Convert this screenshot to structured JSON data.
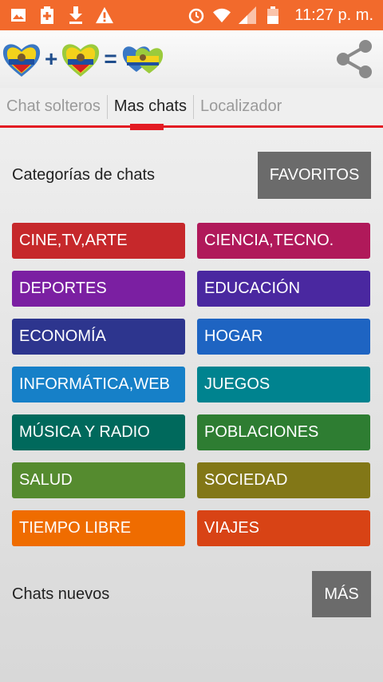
{
  "status_bar": {
    "time": "11:27 p. m.",
    "left_icons": [
      "image-icon",
      "battery-plus-icon",
      "download-icon",
      "warning-icon"
    ],
    "right_icons": [
      "alarm-icon",
      "wifi-icon",
      "signal-icon",
      "battery-icon"
    ]
  },
  "app_bar": {
    "logo_plus": "+",
    "logo_equals": "=",
    "share_icon": "share-icon"
  },
  "tabs": [
    {
      "label": "Chat solteros"
    },
    {
      "label": "Mas chats"
    },
    {
      "label": "Localizador"
    }
  ],
  "active_tab": "Mas chats",
  "categories_section": {
    "title": "Categorías de chats",
    "favorites_button": "FAVORITOS"
  },
  "categories": [
    {
      "label": "CINE,TV,ARTE",
      "color": "#c6282b"
    },
    {
      "label": "CIENCIA,TECNO.",
      "color": "#b0195a"
    },
    {
      "label": "DEPORTES",
      "color": "#7b1fa2"
    },
    {
      "label": "EDUCACIÓN",
      "color": "#4a28a0"
    },
    {
      "label": "ECONOMÍA",
      "color": "#2d358e"
    },
    {
      "label": "HOGAR",
      "color": "#1e64c2"
    },
    {
      "label": "INFORMÁTICA,WEB",
      "color": "#1680c8"
    },
    {
      "label": "JUEGOS",
      "color": "#00838f"
    },
    {
      "label": "MÚSICA Y RADIO",
      "color": "#00695c"
    },
    {
      "label": "POBLACIONES",
      "color": "#2e7d32"
    },
    {
      "label": "SALUD",
      "color": "#558b2f"
    },
    {
      "label": "SOCIEDAD",
      "color": "#827717"
    },
    {
      "label": "TIEMPO LIBRE",
      "color": "#ef6c00"
    },
    {
      "label": "VIAJES",
      "color": "#d84315"
    }
  ],
  "new_chats_section": {
    "title": "Chats nuevos",
    "more_button": "MÁS"
  },
  "colors": {
    "status_bar": "#f26a2c",
    "accent": "#e31b23",
    "gray_button": "#6b6b6b"
  }
}
